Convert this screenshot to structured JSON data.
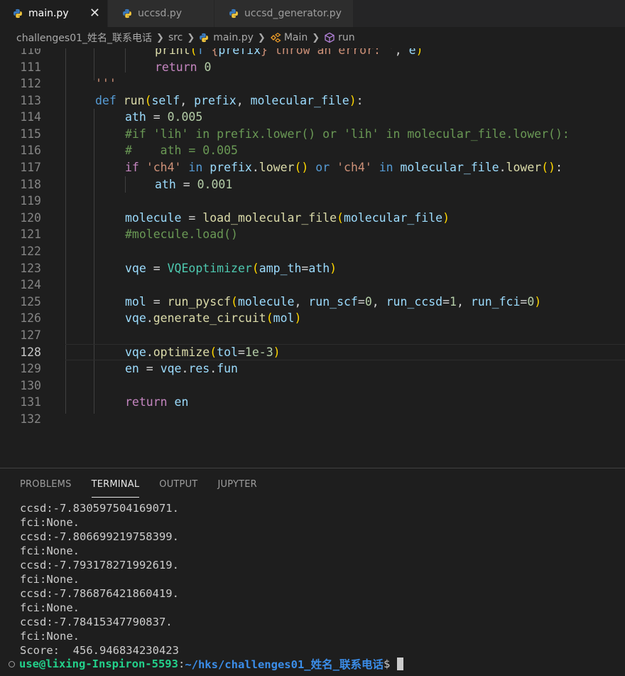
{
  "tabs": [
    {
      "label": "main.py",
      "active": true,
      "icon": "python-icon"
    },
    {
      "label": "uccsd.py",
      "active": false,
      "icon": "python-icon"
    },
    {
      "label": "uccsd_generator.py",
      "active": false,
      "icon": "python-icon"
    }
  ],
  "tab_close": "✕",
  "breadcrumb": {
    "folder": "challenges01_姓名_联系电话",
    "src": "src",
    "file": "main.py",
    "cls": "Main",
    "method": "run"
  },
  "colors": {
    "keyword": "#c586c0",
    "declaration": "#569cd6",
    "function": "#dcdcaa",
    "string": "#ce9178",
    "number": "#b5cea8",
    "comment": "#6a9955",
    "prompt_user": "#23d18b",
    "prompt_path": "#3b8eea"
  },
  "editor": {
    "line_numbers": [
      "110",
      "111",
      "112",
      "113",
      "114",
      "115",
      "116",
      "117",
      "118",
      "119",
      "120",
      "121",
      "122",
      "123",
      "124",
      "125",
      "126",
      "127",
      "128",
      "129",
      "130",
      "131",
      "132"
    ],
    "current_line": "128"
  },
  "panel": {
    "tabs": [
      "PROBLEMS",
      "TERMINAL",
      "OUTPUT",
      "JUPYTER"
    ],
    "active_tab": "TERMINAL"
  },
  "terminal": {
    "lines": [
      "ccsd:-7.830597504169071.",
      "fci:None.",
      "ccsd:-7.806699219758399.",
      "fci:None.",
      "ccsd:-7.793178271992619.",
      "fci:None.",
      "ccsd:-7.786876421860419.",
      "fci:None.",
      "ccsd:-7.78415347790837.",
      "fci:None.",
      "Score:  456.946834230423"
    ],
    "prompt_user": "use@lixing-Inspiron-5593",
    "prompt_sep": ":",
    "prompt_path": "~/hks/challenges01_姓名_联系电话",
    "prompt_symbol": "$"
  }
}
